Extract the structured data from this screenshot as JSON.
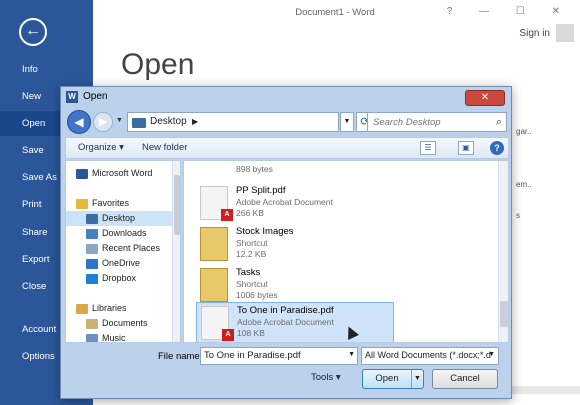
{
  "word": {
    "title": "Document1 - Word",
    "sign_in": "Sign in",
    "heading": "Open",
    "window_controls": "? — ☐ ✕",
    "back_icon": "←",
    "sidebar": [
      "Info",
      "New",
      "Open",
      "Save",
      "Save As",
      "Print",
      "Share",
      "Export",
      "Close",
      "Account",
      "Options"
    ],
    "background_snippets": [
      "gar..",
      "em..",
      "s"
    ]
  },
  "dialog": {
    "title": "Open",
    "close_label": "✕",
    "address": "Desktop",
    "search_placeholder": "Search Desktop",
    "toolbar": {
      "organize": "Organize ▾",
      "new_folder": "New folder"
    },
    "nav_pane": [
      {
        "label": "Microsoft Word",
        "icon": "word-icon",
        "color": "#2b579a"
      },
      {
        "label": "Favorites",
        "icon": "star-icon",
        "color": "#e8b83a"
      },
      {
        "label": "Desktop",
        "icon": "desktop-icon",
        "color": "#3b6ea5",
        "selected": true
      },
      {
        "label": "Downloads",
        "icon": "downloads-icon",
        "color": "#4a7fc0"
      },
      {
        "label": "Recent Places",
        "icon": "recent-places-icon",
        "color": "#8fa6c0"
      },
      {
        "label": "OneDrive",
        "icon": "onedrive-icon",
        "color": "#2e74c8"
      },
      {
        "label": "Dropbox",
        "icon": "dropbox-icon",
        "color": "#1d7fd6"
      },
      {
        "label": "Libraries",
        "icon": "libraries-icon",
        "color": "#d9a84a"
      },
      {
        "label": "Documents",
        "icon": "documents-icon",
        "color": "#c9b27a"
      },
      {
        "label": "Music",
        "icon": "music-icon",
        "color": "#6b8fbf"
      }
    ],
    "files": [
      {
        "name": "",
        "type": "",
        "size": "898 bytes"
      },
      {
        "name": "PP Split.pdf",
        "type": "Adobe Acrobat Document",
        "size": "266 KB"
      },
      {
        "name": "Stock Images",
        "type": "Shortcut",
        "size": "12.2 KB"
      },
      {
        "name": "Tasks",
        "type": "Shortcut",
        "size": "1006 bytes"
      },
      {
        "name": "To One in Paradise.pdf",
        "type": "Adobe Acrobat Document",
        "size": "108 KB",
        "selected": true
      }
    ],
    "file_name_label": "File name:",
    "file_name_value": "To One in Paradise.pdf",
    "file_type_value": "All Word Documents (*.docx;*.d",
    "tools_label": "Tools",
    "open_button": "Open",
    "cancel_button": "Cancel"
  }
}
